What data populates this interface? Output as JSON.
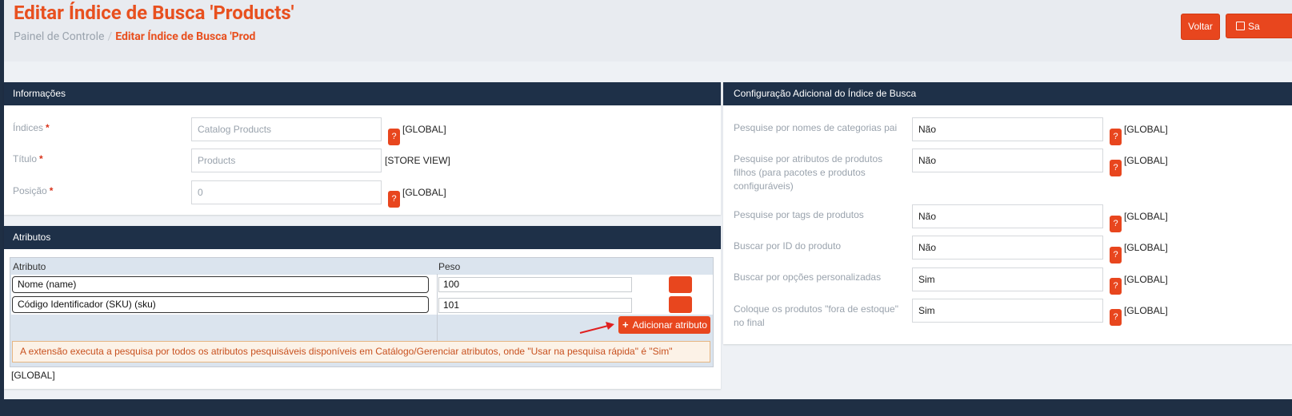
{
  "header": {
    "title": "Editar Índice de Busca 'Products'",
    "breadcrumb_home": "Painel de Controle",
    "breadcrumb_sep": "/",
    "breadcrumb_current": "Editar Índice de Busca 'Prod",
    "back_label": "Voltar",
    "save_label": "Sa"
  },
  "info_panel": {
    "title": "Informações",
    "fields": [
      {
        "label": "Índices",
        "required": "*",
        "value": "Catalog Products",
        "scope": "[GLOBAL]",
        "help": "?"
      },
      {
        "label": "Título",
        "required": "*",
        "value": "Products",
        "scope": "[STORE VIEW]"
      },
      {
        "label": "Posição",
        "required": "*",
        "value": "0",
        "scope": "[GLOBAL]",
        "help": "?"
      }
    ]
  },
  "attributes_panel": {
    "title": "Atributos",
    "col_attribute": "Atributo",
    "col_weight": "Peso",
    "rows": [
      {
        "attribute": "Nome (name)",
        "weight": "100"
      },
      {
        "attribute": "Código Identificador (SKU) (sku)",
        "weight": "101"
      }
    ],
    "add_label": "Adicionar atributo",
    "add_icon": "plus-icon",
    "notice": "A extensão executa a pesquisa por todos os atributos pesquisáveis disponíveis em Catálogo/Gerenciar atributos, onde \"Usar na pesquisa rápida\" é \"Sim\"",
    "scope": "[GLOBAL]"
  },
  "config_panel": {
    "title": "Configuração Adicional do Índice de Busca",
    "fields": [
      {
        "label": "Pesquise por nomes de categorias pai",
        "value": "Não",
        "scope": "[GLOBAL]",
        "help": "?"
      },
      {
        "label": "Pesquise por atributos de produtos filhos (para pacotes e produtos configuráveis)",
        "value": "Não",
        "scope": "[GLOBAL]",
        "help": "?"
      },
      {
        "label": "Pesquise por tags de produtos",
        "value": "Não",
        "scope": "[GLOBAL]",
        "help": "?"
      },
      {
        "label": "Buscar por ID do produto",
        "value": "Não",
        "scope": "[GLOBAL]",
        "help": "?"
      },
      {
        "label": "Buscar por opções personalizadas",
        "value": "Sim",
        "scope": "[GLOBAL]",
        "help": "?"
      },
      {
        "label": "Coloque os produtos \"fora de estoque\" no final",
        "value": "Sim",
        "scope": "[GLOBAL]",
        "help": "?"
      }
    ]
  },
  "colors": {
    "accent": "#e8461e",
    "title": "#e8501f",
    "panel_header": "#1e3048",
    "arrow": "#e02020"
  }
}
